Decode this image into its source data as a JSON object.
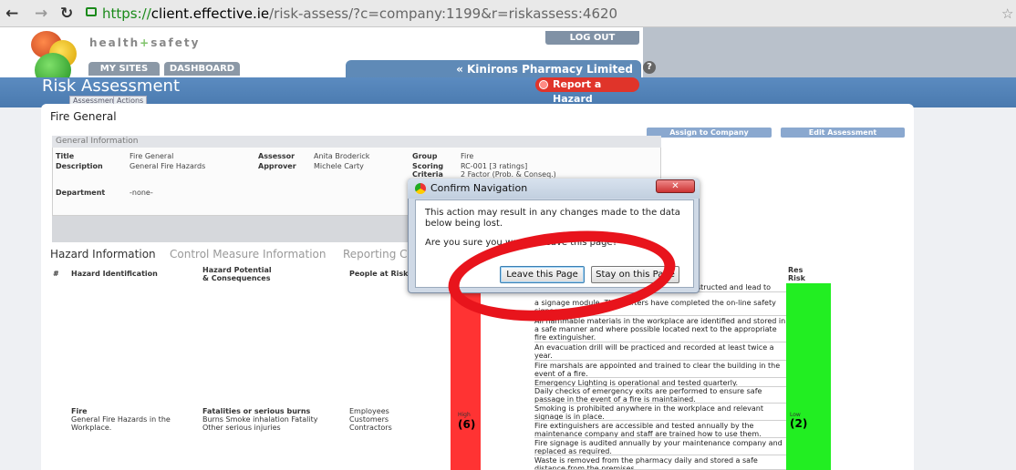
{
  "browser": {
    "url_proto": "https://",
    "url_host": "client.effective.ie",
    "url_path": "/risk-assess/?c=company:1199&r=riskassess:4620",
    "back_icon": "arrow-left-icon",
    "forward_icon": "arrow-right-icon",
    "reload_icon": "reload-icon",
    "star_icon": "star-icon"
  },
  "header": {
    "brand_a": "health",
    "brand_plus": "+",
    "brand_b": "safety",
    "logout": "LOG OUT",
    "tabs": [
      "MY SITES",
      "DASHBOARD"
    ],
    "company": "« Kinirons Pharmacy Limited",
    "help": "?"
  },
  "page": {
    "title": "Risk Assessment",
    "subtabs": [
      "Assessments",
      "Actions"
    ],
    "report_hazard": "Report a Hazard"
  },
  "assessment": {
    "name": "Fire General",
    "assign_button": "Assign to Company",
    "edit_button": "Edit Assessment",
    "general_info_heading": "General Information",
    "title_label": "Title",
    "title_value": "Fire General",
    "description_label": "Description",
    "description_value": "General Fire Hazards",
    "department_label": "Department",
    "department_value": "-none-",
    "assessor_label": "Assessor",
    "assessor_value": "Anita Broderick",
    "approver_label": "Approver",
    "approver_value": "Michele Carty",
    "group_label": "Group",
    "group_value": "Fire",
    "scoring_label": "Scoring",
    "scoring_value": "RC-001 [3 ratings]",
    "criteria_label": "Criteria",
    "criteria_value": "2 Factor (Prob. & Conseq.)"
  },
  "hazard": {
    "tabs": [
      "Hazard Information",
      "Control Measure Information",
      "Reporting C"
    ],
    "col_num": "#",
    "col_identification": "Hazard Identification",
    "col_potential_a": "Hazard Potential",
    "col_potential_b": "& Consequences",
    "col_people": "People at Risk",
    "col_res_a": "Res",
    "col_res_b": "Risk",
    "row": {
      "hazard_name": "Fire",
      "hazard_desc_a": "General Fire Hazards in the",
      "hazard_desc_b": "Workplace.",
      "potential_title": "Fatalities or serious burns",
      "potential_a": "Burns Smoke inhalation Fatality",
      "potential_b": "Other serious injuries",
      "people": [
        "Employees",
        "Customers",
        "Contractors"
      ],
      "initial_level": "High",
      "initial_value": "(6)",
      "residual_level": "Low",
      "residual_value": "(2)",
      "controls": [
        "structed and lead to",
        "a signage module. The starters have completed the on-line safety signage module.",
        "All flammable materials in the workplace are identified and stored in a safe manner and where possible located next to the appropriate fire extinguisher.",
        "An evacuation drill will be practiced and recorded at least twice a year.",
        "Fire marshals are appointed and trained to clear the building in the event of a fire.",
        "Emergency Lighting is operational and tested quarterly.",
        "Daily checks of emergency exits are performed to ensure safe passage in the event of a fire is maintained.",
        "Smoking is prohibited anywhere in the workplace and relevant signage is in place.",
        "Fire extinguishers are accessible and tested annually by the maintenance company and staff are trained how to use them.",
        "Fire signage is audited annually by your maintenance company and replaced as required.",
        "Waste is removed from the pharmacy daily and stored a safe distance from the premises."
      ]
    }
  },
  "dialog": {
    "title": "Confirm Navigation",
    "close": "✕",
    "message": "This action may result in any changes made to the data below being lost.",
    "question": "Are you sure you want to leave this page?",
    "leave": "Leave this Page",
    "stay": "Stay on this Page"
  }
}
